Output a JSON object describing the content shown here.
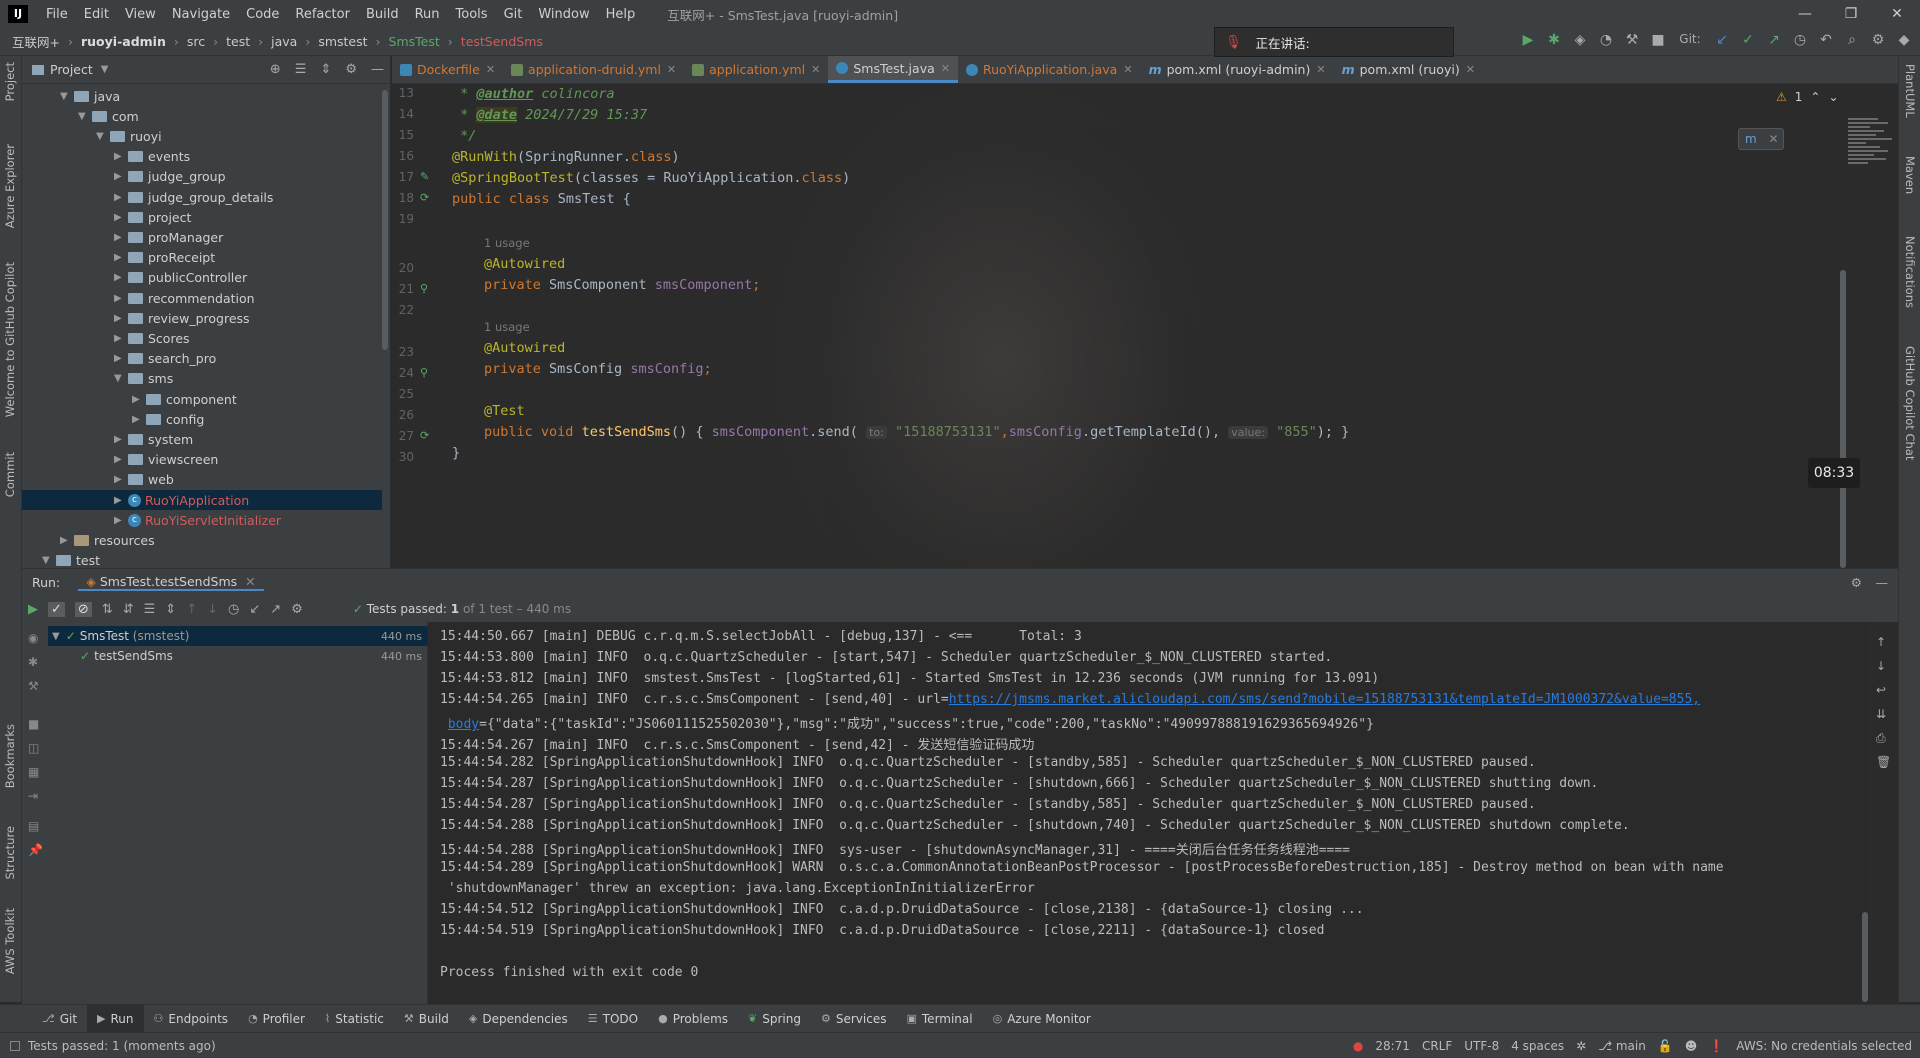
{
  "app": {
    "logo": "IJ",
    "window_title": "互联网+ - SmsTest.java [ruoyi-admin]"
  },
  "menu": [
    "File",
    "Edit",
    "View",
    "Navigate",
    "Code",
    "Refactor",
    "Build",
    "Run",
    "Tools",
    "Git",
    "Window",
    "Help"
  ],
  "window_controls": {
    "minimize": "—",
    "maximize": "❐",
    "close": "✕"
  },
  "breadcrumb": [
    "互联网+",
    "ruoyi-admin",
    "src",
    "test",
    "java",
    "smstest",
    "SmsTest",
    "testSendSms"
  ],
  "speaking_overlay": {
    "text": "正在讲话:",
    "dropdown_fragment": "ns"
  },
  "git_label": "Git:",
  "left_strip": [
    "Project",
    "Azure Explorer",
    "Welcome to GitHub Copilot",
    "Commit",
    "Bookmarks",
    "Structure",
    "AWS Toolkit"
  ],
  "right_strip": [
    "PlantUML",
    "Maven",
    "Notifications",
    "GitHub Copilot Chat"
  ],
  "project_panel": {
    "title": "Project",
    "tree": [
      {
        "label": "java",
        "indent": 3,
        "expanded": true,
        "kind": "folder"
      },
      {
        "label": "com",
        "indent": 4,
        "expanded": true,
        "kind": "folder"
      },
      {
        "label": "ruoyi",
        "indent": 5,
        "expanded": true,
        "kind": "folder"
      },
      {
        "label": "events",
        "indent": 6,
        "expanded": false,
        "kind": "folder"
      },
      {
        "label": "judge_group",
        "indent": 6,
        "expanded": false,
        "kind": "folder"
      },
      {
        "label": "judge_group_details",
        "indent": 6,
        "expanded": false,
        "kind": "folder"
      },
      {
        "label": "project",
        "indent": 6,
        "expanded": false,
        "kind": "folder"
      },
      {
        "label": "proManager",
        "indent": 6,
        "expanded": false,
        "kind": "folder"
      },
      {
        "label": "proReceipt",
        "indent": 6,
        "expanded": false,
        "kind": "folder"
      },
      {
        "label": "publicController",
        "indent": 6,
        "expanded": false,
        "kind": "folder"
      },
      {
        "label": "recommendation",
        "indent": 6,
        "expanded": false,
        "kind": "folder"
      },
      {
        "label": "review_progress",
        "indent": 6,
        "expanded": false,
        "kind": "folder"
      },
      {
        "label": "Scores",
        "indent": 6,
        "expanded": false,
        "kind": "folder"
      },
      {
        "label": "search_pro",
        "indent": 6,
        "expanded": false,
        "kind": "folder"
      },
      {
        "label": "sms",
        "indent": 6,
        "expanded": true,
        "kind": "folder"
      },
      {
        "label": "component",
        "indent": 7,
        "expanded": false,
        "kind": "folder"
      },
      {
        "label": "config",
        "indent": 7,
        "expanded": false,
        "kind": "folder"
      },
      {
        "label": "system",
        "indent": 6,
        "expanded": false,
        "kind": "folder"
      },
      {
        "label": "viewscreen",
        "indent": 6,
        "expanded": false,
        "kind": "folder"
      },
      {
        "label": "web",
        "indent": 6,
        "expanded": false,
        "kind": "folder"
      },
      {
        "label": "RuoYiApplication",
        "indent": 6,
        "expanded": false,
        "kind": "class",
        "selected": true
      },
      {
        "label": "RuoYiServletInitializer",
        "indent": 6,
        "expanded": false,
        "kind": "class"
      },
      {
        "label": "resources",
        "indent": 3,
        "expanded": false,
        "kind": "res"
      },
      {
        "label": "test",
        "indent": 2,
        "expanded": true,
        "kind": "folder"
      }
    ]
  },
  "tabs": [
    {
      "label": "Dockerfile",
      "active": false,
      "kind": "docker"
    },
    {
      "label": "application-druid.yml",
      "active": false,
      "kind": "yml"
    },
    {
      "label": "application.yml",
      "active": false,
      "kind": "yml"
    },
    {
      "label": "SmsTest.java",
      "active": true,
      "kind": "java"
    },
    {
      "label": "RuoYiApplication.java",
      "active": false,
      "kind": "java"
    },
    {
      "label": "pom.xml (ruoyi-admin)",
      "active": false,
      "kind": "maven"
    },
    {
      "label": "pom.xml (ruoyi)",
      "active": false,
      "kind": "maven"
    }
  ],
  "editor": {
    "warnings": "1",
    "lines": {
      "l13": "13",
      "l14": "14",
      "l15": "15",
      "l16": "16",
      "l17": "17",
      "l18": "18",
      "l19": "19",
      "l20": "20",
      "l21": "21",
      "l22": "22",
      "l23": "23",
      "l24": "24",
      "l25": "25",
      "l26": "26",
      "l27": "27",
      "l30": "30"
    },
    "author_tag": "@author",
    "author": " colincora",
    "date_tag": "@date",
    "date": " 2024/7/29 15:37",
    "comment_end": " */",
    "runwith": "@RunWith",
    "runwith_arg": "(SpringRunner.",
    "class_kw": "class",
    "close_paren": ")",
    "sbt": "@SpringBootTest",
    "sbt_arg": "(classes = RuoYiApplication.",
    "public_kw": "public",
    "class_decl": " SmsTest {",
    "usage1": "1 usage",
    "autowired": "@Autowired",
    "private_kw": "private",
    "type1": " SmsComponent ",
    "field1": "smsComponent",
    "semi": ";",
    "usage2": "1 usage",
    "type2": " SmsConfig ",
    "field2": "smsConfig",
    "test_ann": "@Test",
    "void_kw": " void ",
    "method": "testSendSms",
    "method_open": "() { ",
    "call_obj": "smsComponent",
    "call": ".send(",
    "hint_to": "to:",
    "arg1": "\"15188753131\"",
    "arg2_pre": ",",
    "arg2_obj": "smsConfig",
    "arg2": ".getTemplateId(),",
    "hint_value": "value:",
    "arg3": "\"855\"",
    "call_end": "); }",
    "closing": "}"
  },
  "clock": "08:33",
  "run": {
    "label": "Run:",
    "config": "SmsTest.testSendSms",
    "status": "Tests passed:",
    "passed_count": "1",
    "of": "of 1 test – 440 ms",
    "tree": [
      {
        "name": "SmsTest",
        "sub": "(smstest)",
        "time": "440 ms"
      },
      {
        "name": "testSendSms",
        "sub": "",
        "time": "440 ms"
      }
    ]
  },
  "console": {
    "c1": "15:44:50.667 [main] DEBUG c.r.q.m.S.selectJobAll - [debug,137] - <==      Total: 3",
    "c2": "15:44:53.800 [main] INFO  o.q.c.QuartzScheduler - [start,547] - Scheduler quartzScheduler_$_NON_CLUSTERED started.",
    "c3": "15:44:53.812 [main] INFO  smstest.SmsTest - [logStarted,61] - Started SmsTest in 12.236 seconds (JVM running for 13.091)",
    "c4_pre": "15:44:54.265 [main] INFO  c.r.s.c.SmsComponent - [send,40] - url=",
    "c4_link": "https://jmsms.market.alicloudapi.com/sms/send?mobile=15188753131&templateId=JM1000372&value=855,",
    "c5_link": "body",
    "c5_rest": "={\"data\":{\"taskId\":\"JS060111525502030\"},\"msg\":\"成功\",\"success\":true,\"code\":200,\"taskNo\":\"490997888191629365694926\"}",
    "c6": "15:44:54.267 [main] INFO  c.r.s.c.SmsComponent - [send,42] - 发送短信验证码成功",
    "c7": "15:44:54.282 [SpringApplicationShutdownHook] INFO  o.q.c.QuartzScheduler - [standby,585] - Scheduler quartzScheduler_$_NON_CLUSTERED paused.",
    "c8": "15:44:54.287 [SpringApplicationShutdownHook] INFO  o.q.c.QuartzScheduler - [shutdown,666] - Scheduler quartzScheduler_$_NON_CLUSTERED shutting down.",
    "c9": "15:44:54.287 [SpringApplicationShutdownHook] INFO  o.q.c.QuartzScheduler - [standby,585] - Scheduler quartzScheduler_$_NON_CLUSTERED paused.",
    "c10": "15:44:54.288 [SpringApplicationShutdownHook] INFO  o.q.c.QuartzScheduler - [shutdown,740] - Scheduler quartzScheduler_$_NON_CLUSTERED shutdown complete.",
    "c11": "15:44:54.288 [SpringApplicationShutdownHook] INFO  sys-user - [shutdownAsyncManager,31] - ====关闭后台任务任务线程池====",
    "c12": "15:44:54.289 [SpringApplicationShutdownHook] WARN  o.s.c.a.CommonAnnotationBeanPostProcessor - [postProcessBeforeDestruction,185] - Destroy method on bean with name",
    "c13": " 'shutdownManager' threw an exception: java.lang.ExceptionInInitializerError",
    "c14": "15:44:54.512 [SpringApplicationShutdownHook] INFO  c.a.d.p.DruidDataSource - [close,2138] - {dataSource-1} closing ...",
    "c15": "15:44:54.519 [SpringApplicationShutdownHook] INFO  c.a.d.p.DruidDataSource - [close,2211] - {dataSource-1} closed",
    "c16": "Process finished with exit code 0"
  },
  "tool_tabs": [
    "Git",
    "Run",
    "Endpoints",
    "Profiler",
    "Statistic",
    "Build",
    "Dependencies",
    "TODO",
    "Problems",
    "Spring",
    "Services",
    "Terminal",
    "Azure Monitor"
  ],
  "status": {
    "left": "Tests passed: 1 (moments ago)",
    "position": "28:71",
    "line_sep": "CRLF",
    "encoding": "UTF-8",
    "indent": "4 spaces",
    "branch": "main",
    "aws": "AWS: No credentials selected"
  },
  "colors": {
    "accent": "#4a88c7",
    "keyword": "#cc7832",
    "string": "#6a8759",
    "annotation": "#bbb529",
    "field": "#9876aa",
    "pass": "#59a869",
    "error": "#e0443e"
  }
}
